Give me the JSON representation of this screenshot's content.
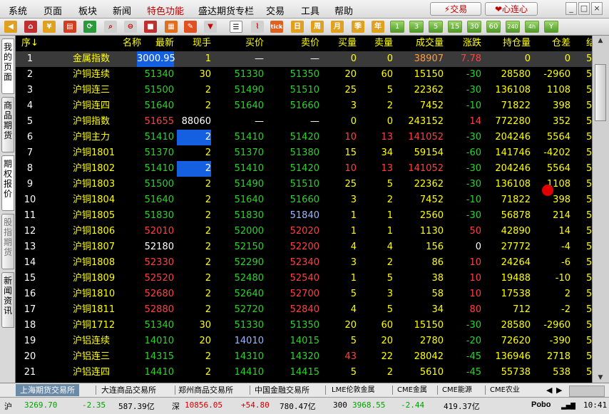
{
  "menu": [
    "系统",
    "页面",
    "板块",
    "新闻",
    "特色功能",
    "盛达期货专栏",
    "交易",
    "工具",
    "帮助"
  ],
  "trade_btn": "交易",
  "heart_btn": "心连心",
  "toolbar_icons": [
    "back-arrow-icon",
    "home-icon",
    "coin-icon",
    "news-icon",
    "refresh-icon",
    "search-icon",
    "zoom-out-icon",
    "red-square-icon",
    "grid-icon",
    "chart-icon",
    "pen-icon",
    "filter-icon",
    "list-icon",
    "line-chart-icon",
    "tick-icon",
    "day-icon",
    "week-icon",
    "month-icon",
    "season-icon",
    "year-icon"
  ],
  "toolbar_labels": {
    "tick": "tick",
    "day": "日",
    "week": "周",
    "month": "月",
    "season": "季",
    "year": "年"
  },
  "periods": [
    "1",
    "3",
    "5",
    "15",
    "30",
    "60",
    "240",
    "4h",
    "Y"
  ],
  "side_tabs": [
    "我的页面",
    "商品期货",
    "期权报价",
    "股指期货",
    "新闻资讯"
  ],
  "columns": {
    "seq": "序↓",
    "name": "名称",
    "last": "最新",
    "now": "现手",
    "bid": "买价",
    "ask": "卖价",
    "bid_qty": "买量",
    "ask_qty": "卖量",
    "volume": "成交量",
    "change": "涨跌",
    "oi": "持仓量",
    "oi_diff": "仓差",
    "more": "结"
  },
  "rows": [
    {
      "seq": "1",
      "name": "金属指数",
      "last": "3000.95",
      "now": "1",
      "bid": "—",
      "ask": "—",
      "bq": "0",
      "aq": "0",
      "vol": "38907",
      "chg": "7.78",
      "oi": "0",
      "diff": "0"
    },
    {
      "seq": "2",
      "name": "沪铜连续",
      "last": "51340",
      "now": "30",
      "bid": "51330",
      "ask": "51350",
      "bq": "20",
      "aq": "60",
      "vol": "15150",
      "chg": "-30",
      "oi": "28580",
      "diff": "-2960"
    },
    {
      "seq": "3",
      "name": "沪铜连三",
      "last": "51500",
      "now": "2",
      "bid": "51490",
      "ask": "51510",
      "bq": "25",
      "aq": "5",
      "vol": "22362",
      "chg": "-30",
      "oi": "136108",
      "diff": "1108"
    },
    {
      "seq": "4",
      "name": "沪铜连四",
      "last": "51640",
      "now": "2",
      "bid": "51640",
      "ask": "51660",
      "bq": "3",
      "aq": "2",
      "vol": "7452",
      "chg": "-10",
      "oi": "71822",
      "diff": "398"
    },
    {
      "seq": "5",
      "name": "沪铜指数",
      "last": "51655",
      "now": "88060",
      "bid": "—",
      "ask": "—",
      "bq": "0",
      "aq": "0",
      "vol": "243152",
      "chg": "14",
      "oi": "772280",
      "diff": "352"
    },
    {
      "seq": "6",
      "name": "沪铜主力",
      "last": "51410",
      "now": "2",
      "bid": "51410",
      "ask": "51420",
      "bq": "10",
      "aq": "13",
      "vol": "141052",
      "chg": "-30",
      "oi": "204246",
      "diff": "5564"
    },
    {
      "seq": "7",
      "name": "沪铜1801",
      "last": "51370",
      "now": "2",
      "bid": "51370",
      "ask": "51380",
      "bq": "15",
      "aq": "34",
      "vol": "59154",
      "chg": "-60",
      "oi": "141746",
      "diff": "-4202"
    },
    {
      "seq": "8",
      "name": "沪铜1802",
      "last": "51410",
      "now": "2",
      "bid": "51410",
      "ask": "51420",
      "bq": "10",
      "aq": "13",
      "vol": "141052",
      "chg": "-30",
      "oi": "204246",
      "diff": "5564"
    },
    {
      "seq": "9",
      "name": "沪铜1803",
      "last": "51500",
      "now": "2",
      "bid": "51490",
      "ask": "51510",
      "bq": "25",
      "aq": "5",
      "vol": "22362",
      "chg": "-30",
      "oi": "136108",
      "diff": "1108"
    },
    {
      "seq": "10",
      "name": "沪铜1804",
      "last": "51640",
      "now": "2",
      "bid": "51640",
      "ask": "51660",
      "bq": "3",
      "aq": "2",
      "vol": "7452",
      "chg": "-10",
      "oi": "71822",
      "diff": "398"
    },
    {
      "seq": "11",
      "name": "沪铜1805",
      "last": "51830",
      "now": "2",
      "bid": "51830",
      "ask": "51840",
      "bq": "1",
      "aq": "1",
      "vol": "2560",
      "chg": "-30",
      "oi": "56878",
      "diff": "214"
    },
    {
      "seq": "12",
      "name": "沪铜1806",
      "last": "52010",
      "now": "2",
      "bid": "52000",
      "ask": "52020",
      "bq": "1",
      "aq": "1",
      "vol": "1130",
      "chg": "50",
      "oi": "42890",
      "diff": "14"
    },
    {
      "seq": "13",
      "name": "沪铜1807",
      "last": "52180",
      "now": "2",
      "bid": "52150",
      "ask": "52200",
      "bq": "4",
      "aq": "4",
      "vol": "156",
      "chg": "0",
      "oi": "27772",
      "diff": "-4"
    },
    {
      "seq": "14",
      "name": "沪铜1808",
      "last": "52330",
      "now": "2",
      "bid": "52290",
      "ask": "52340",
      "bq": "3",
      "aq": "2",
      "vol": "86",
      "chg": "10",
      "oi": "24264",
      "diff": "-6"
    },
    {
      "seq": "15",
      "name": "沪铜1809",
      "last": "52520",
      "now": "2",
      "bid": "52480",
      "ask": "52540",
      "bq": "1",
      "aq": "5",
      "vol": "38",
      "chg": "10",
      "oi": "19488",
      "diff": "-10"
    },
    {
      "seq": "16",
      "name": "沪铜1810",
      "last": "52680",
      "now": "2",
      "bid": "52640",
      "ask": "52700",
      "bq": "5",
      "aq": "3",
      "vol": "58",
      "chg": "10",
      "oi": "17538",
      "diff": "2"
    },
    {
      "seq": "17",
      "name": "沪铜1811",
      "last": "52880",
      "now": "2",
      "bid": "52720",
      "ask": "52840",
      "bq": "4",
      "aq": "5",
      "vol": "34",
      "chg": "80",
      "oi": "712",
      "diff": "-2"
    },
    {
      "seq": "18",
      "name": "沪铜1712",
      "last": "51340",
      "now": "30",
      "bid": "51330",
      "ask": "51350",
      "bq": "20",
      "aq": "60",
      "vol": "15150",
      "chg": "-30",
      "oi": "28580",
      "diff": "-2960"
    },
    {
      "seq": "19",
      "name": "沪铝连续",
      "last": "14010",
      "now": "20",
      "bid": "14010",
      "ask": "14015",
      "bq": "5",
      "aq": "20",
      "vol": "2780",
      "chg": "-20",
      "oi": "72620",
      "diff": "-390"
    },
    {
      "seq": "20",
      "name": "沪铝连三",
      "last": "14315",
      "now": "2",
      "bid": "14310",
      "ask": "14320",
      "bq": "43",
      "aq": "22",
      "vol": "28042",
      "chg": "-45",
      "oi": "136946",
      "diff": "2718"
    },
    {
      "seq": "21",
      "name": "沪铝连四",
      "last": "14410",
      "now": "2",
      "bid": "14410",
      "ask": "14415",
      "bq": "5",
      "aq": "2",
      "vol": "5610",
      "chg": "-45",
      "oi": "55738",
      "diff": "538"
    }
  ],
  "exchange_tabs": [
    "上海期货交易所",
    "大连商品交易所",
    "郑州商品交易所",
    "中国金融交易所",
    "LME伦敦金属",
    "CME金属",
    "CME能源",
    "CME农业"
  ],
  "status": {
    "sh_label": "沪",
    "sh_value": "3269.70",
    "sh_change": "-2.35",
    "sh_amount": "587.39亿",
    "sz_label": "深",
    "sz_value": "10856.05",
    "sz_change": "+54.80",
    "sz_amount": "780.47亿",
    "c3_label": "300",
    "c3_value": "3968.55",
    "c3_change": "-2.44",
    "c3_amount": "419.37亿",
    "brand": "Pobo",
    "time": "10:41"
  }
}
